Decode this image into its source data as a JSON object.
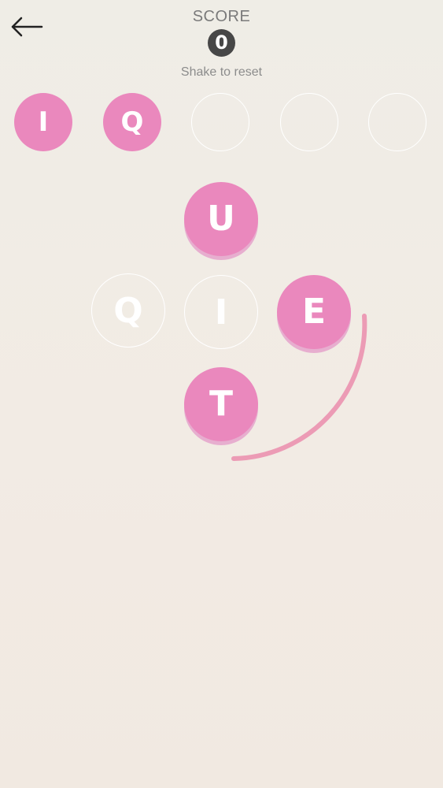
{
  "header": {
    "score_label": "SCORE",
    "score_value": "0",
    "reset_hint": "Shake to reset",
    "back_icon": "arrow-left-icon"
  },
  "answer_slots": [
    {
      "letter": "I",
      "state": "filled"
    },
    {
      "letter": "Q",
      "state": "filled"
    },
    {
      "letter": "",
      "state": "empty"
    },
    {
      "letter": "",
      "state": "empty"
    },
    {
      "letter": "",
      "state": "empty"
    }
  ],
  "letter_tiles": [
    {
      "letter": "U",
      "state": "active"
    },
    {
      "letter": "Q",
      "state": "used"
    },
    {
      "letter": "I",
      "state": "used"
    },
    {
      "letter": "E",
      "state": "active"
    },
    {
      "letter": "T",
      "state": "active"
    }
  ],
  "colors": {
    "tile_pink": "#ea88bd",
    "tile_shadow": "#e7aecf",
    "trail": "#ec9bb5",
    "score_badge": "#474747",
    "background": "#efede6"
  }
}
